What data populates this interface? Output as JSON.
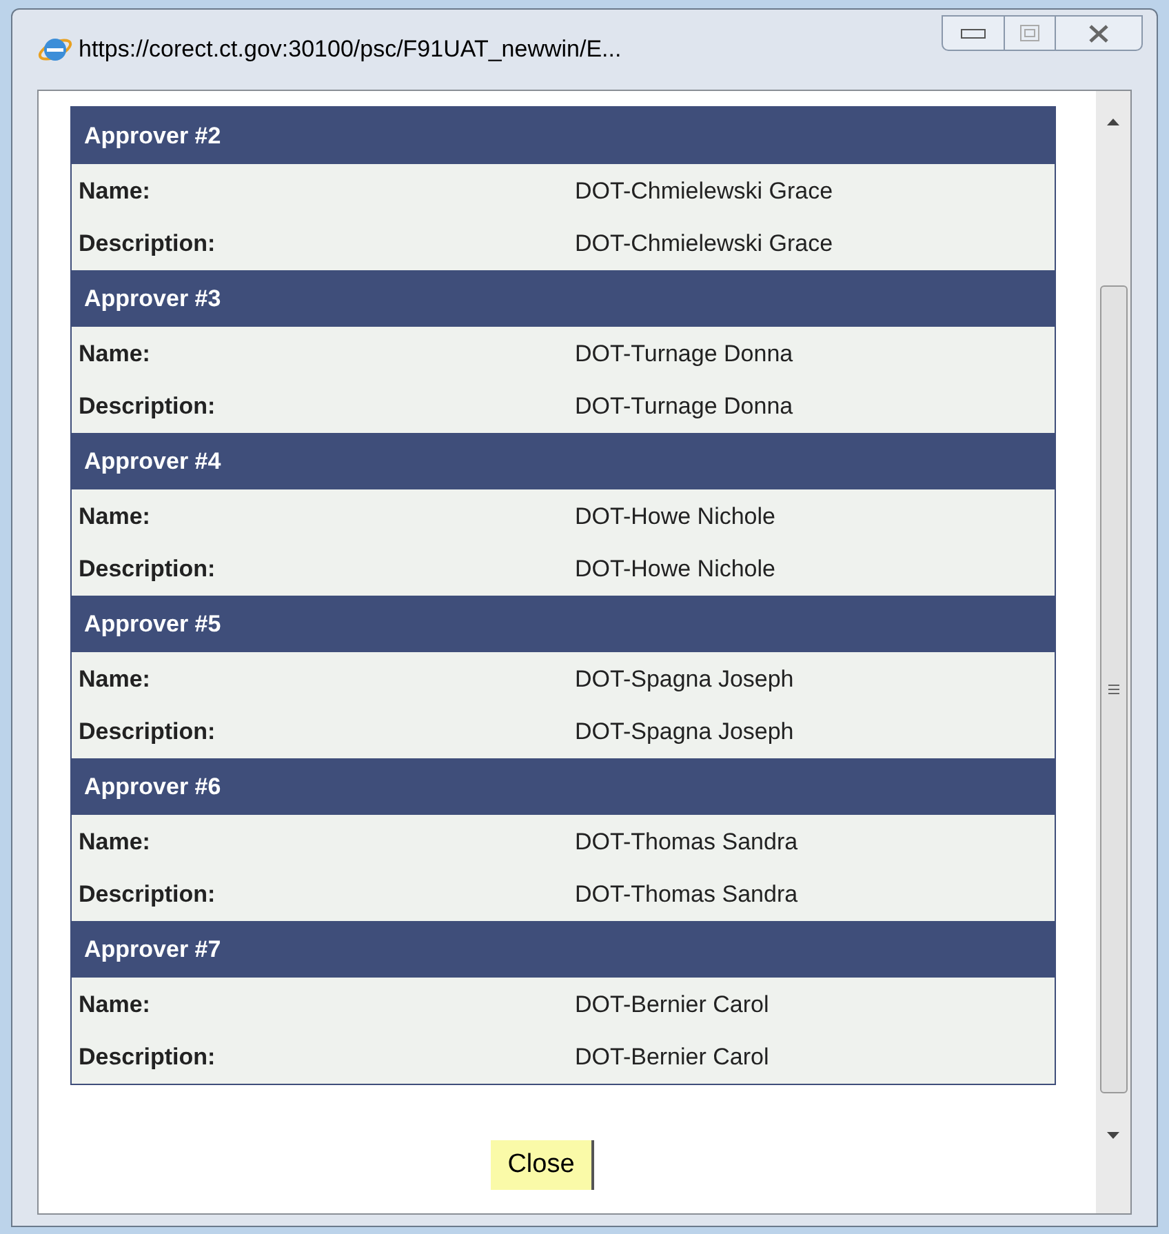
{
  "window": {
    "title": "https://corect.ct.gov:30100/psc/F91UAT_newwin/E..."
  },
  "approvers": [
    {
      "heading": "Approver #2",
      "fields": [
        {
          "label": "Name:",
          "value": "DOT-Chmielewski Grace"
        },
        {
          "label": "Description:",
          "value": "DOT-Chmielewski Grace"
        }
      ]
    },
    {
      "heading": "Approver #3",
      "fields": [
        {
          "label": "Name:",
          "value": "DOT-Turnage Donna"
        },
        {
          "label": "Description:",
          "value": "DOT-Turnage Donna"
        }
      ]
    },
    {
      "heading": "Approver #4",
      "fields": [
        {
          "label": "Name:",
          "value": "DOT-Howe Nichole"
        },
        {
          "label": "Description:",
          "value": "DOT-Howe Nichole"
        }
      ]
    },
    {
      "heading": "Approver #5",
      "fields": [
        {
          "label": "Name:",
          "value": "DOT-Spagna Joseph"
        },
        {
          "label": "Description:",
          "value": "DOT-Spagna Joseph"
        }
      ]
    },
    {
      "heading": "Approver #6",
      "fields": [
        {
          "label": "Name:",
          "value": "DOT-Thomas Sandra"
        },
        {
          "label": "Description:",
          "value": "DOT-Thomas Sandra"
        }
      ]
    },
    {
      "heading": "Approver #7",
      "fields": [
        {
          "label": "Name:",
          "value": "DOT-Bernier Carol"
        },
        {
          "label": "Description:",
          "value": "DOT-Bernier Carol"
        }
      ]
    }
  ],
  "close_button": {
    "label": "Close"
  }
}
